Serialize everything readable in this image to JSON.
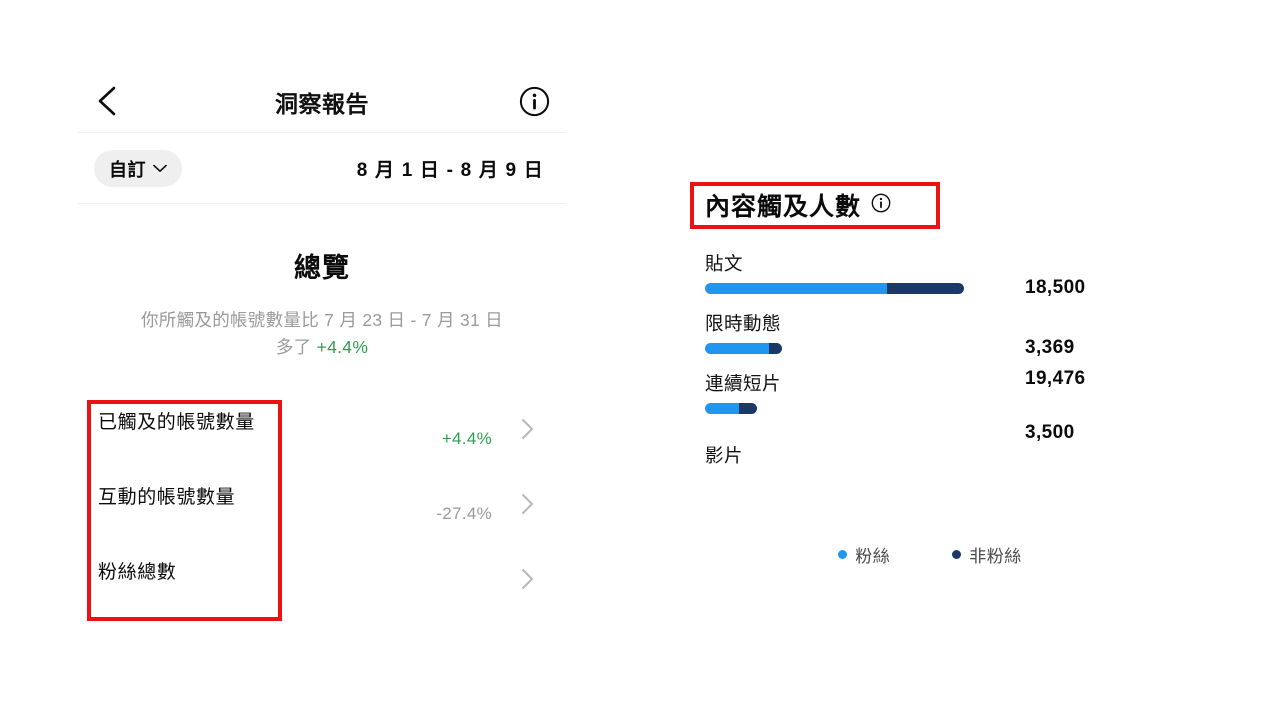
{
  "left_panel": {
    "nav": {
      "back_icon": "back-chevron-icon",
      "title": "洞察報告",
      "info_icon": "info-circle-icon"
    },
    "date_bar": {
      "custom_label": "自訂",
      "dropdown_icon": "chevron-down-icon",
      "date_range": "8 月 1 日 - 8 月 9 日"
    },
    "overview": {
      "title": "總覽",
      "subtitle_prefix": "你所觸及的帳號數量比 7 月 23 日 - 7 月 31 日 多了 ",
      "subtitle_delta": "+4.4%"
    },
    "metrics": [
      {
        "label": "已觸及的帳號數量",
        "delta": "+4.4%",
        "delta_sign": "pos",
        "chevron_icon": "chevron-right-icon"
      },
      {
        "label": "互動的帳號數量",
        "delta": "-27.4%",
        "delta_sign": "neg",
        "chevron_icon": "chevron-right-icon"
      },
      {
        "label": "粉絲總數",
        "delta": "",
        "delta_sign": "none",
        "chevron_icon": "chevron-right-icon"
      }
    ]
  },
  "right_panel": {
    "header": {
      "title": "內容觸及人數",
      "info_icon": "info-circle-icon"
    },
    "legend": [
      {
        "label": "粉絲",
        "color": "#1f96f0"
      },
      {
        "label": "非粉絲",
        "color": "#1c3866"
      }
    ]
  },
  "colors": {
    "followers": "#1f96f0",
    "nonfollowers": "#1c3866",
    "positive": "#2e9e52",
    "negative": "#9a9a9a",
    "annotation_box": "#ee1111"
  },
  "chart_data": {
    "type": "bar",
    "title": "內容觸及人數",
    "xlabel": "",
    "ylabel": "",
    "orientation": "horizontal",
    "stacked": true,
    "categories": [
      "貼文",
      "限時動態",
      "連續短片",
      "影片"
    ],
    "value_labels": [
      "18,500",
      "3,369",
      "19,476",
      "3,500"
    ],
    "values": [
      18500,
      3369,
      19476,
      3500
    ],
    "series": [
      {
        "name": "粉絲",
        "color": "#1f96f0",
        "pixel_widths": [
          182,
          64,
          34,
          0
        ]
      },
      {
        "name": "非粉絲",
        "color": "#1c3866",
        "pixel_widths": [
          77,
          13,
          18,
          0
        ]
      }
    ],
    "legend_position": "bottom",
    "grid": false
  }
}
